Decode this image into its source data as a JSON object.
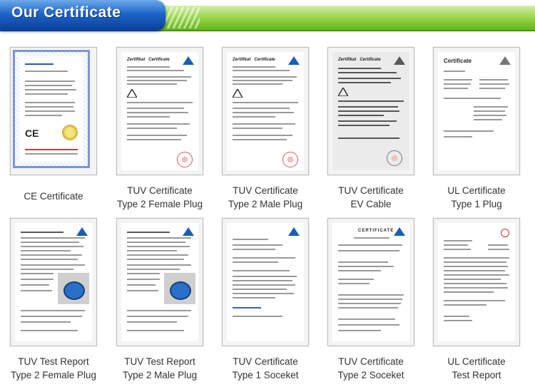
{
  "header": {
    "title": "Our Certificate"
  },
  "colors": {
    "header_blue": "#1b63c9",
    "header_green": "#63b51c",
    "caption_text": "#333333"
  },
  "certificates": [
    {
      "line1": "CE Certificate",
      "line2": ""
    },
    {
      "line1": "TUV Certificate",
      "line2": "Type 2 Female Plug"
    },
    {
      "line1": "TUV Certificate",
      "line2": "Type 2 Male Plug"
    },
    {
      "line1": "TUV Certificate",
      "line2": "EV Cable"
    },
    {
      "line1": "UL Certificate",
      "line2": "Type 1 Plug"
    },
    {
      "line1": "TUV Test Report",
      "line2": "Type 2 Female Plug"
    },
    {
      "line1": "TUV Test Report",
      "line2": "Type 2 Male Plug"
    },
    {
      "line1": "TUV Certificate",
      "line2": "Type 1 Soceket"
    },
    {
      "line1": "TUV Certificate",
      "line2": "Type 2 Soceket"
    },
    {
      "line1": "UL Certificate",
      "line2": "Test Report"
    }
  ]
}
